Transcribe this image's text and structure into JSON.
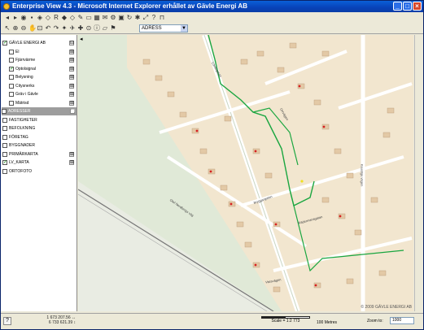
{
  "window": {
    "title": "Enterprise View 4.3 - Microsoft Internet Explorer erhållet av Gävle Energi AB",
    "min": "_",
    "max": "□",
    "close": "×"
  },
  "toolbar": {
    "address_value": "ADRESS",
    "dropdown_glyph": "▼"
  },
  "layers": [
    {
      "label": "GÄVLE ENERGI AB",
      "checked": true,
      "expand": "⊟"
    },
    {
      "label": "El",
      "checked": false,
      "expand": "⊞"
    },
    {
      "label": "Fjärrvärme",
      "checked": false,
      "expand": "⊞"
    },
    {
      "label": "Optolsignal",
      "checked": true,
      "expand": "⊞"
    },
    {
      "label": "Belysning",
      "checked": false,
      "expand": "⊞"
    },
    {
      "label": "Citysnerks",
      "checked": false,
      "expand": "⊞"
    },
    {
      "label": "Gräv i Gävle",
      "checked": false,
      "expand": "⊞"
    },
    {
      "label": "Mätrisd",
      "checked": false,
      "expand": "⊞"
    },
    {
      "label": "ADRESSER",
      "checked": false,
      "expand": "⊞",
      "selected": true
    },
    {
      "label": "FASTIGHETER",
      "checked": false,
      "expand": ""
    },
    {
      "label": "BEFOLKNING",
      "checked": false,
      "expand": ""
    },
    {
      "label": "FÖRETAG",
      "checked": false,
      "expand": ""
    },
    {
      "label": "BYGGNADER",
      "checked": false,
      "expand": ""
    },
    {
      "label": "PRIMÄRKARTA",
      "checked": false,
      "expand": "⊞"
    },
    {
      "label": "LV_KARTA",
      "checked": true,
      "expand": "⊞"
    },
    {
      "label": "ORTOFOTO",
      "checked": false,
      "expand": ""
    }
  ],
  "status": {
    "help": "?",
    "coord_x": "1 673 207.56 ↔",
    "coord_y": "6 733 621.39 ↕",
    "scale": "Scale = 1:2 773",
    "scale_unit": "100 Metres",
    "zoom_label": "Zoom to:",
    "zoom_value": "1000"
  },
  "map": {
    "copyright": "© 2009 GÄVLE ENERGI AB",
    "streets": [
      "Lövåsgatan",
      "Olof Nordbergs väg",
      "Bryggargatan",
      "Rädermansgatan",
      "Kaustiga vägen",
      "Orrvägen",
      "Vassvägen"
    ],
    "colors": {
      "fiber": "#1aa640",
      "road": "#ffffff",
      "building": "#e3c9a6",
      "plot": "#f2e6cf"
    }
  }
}
